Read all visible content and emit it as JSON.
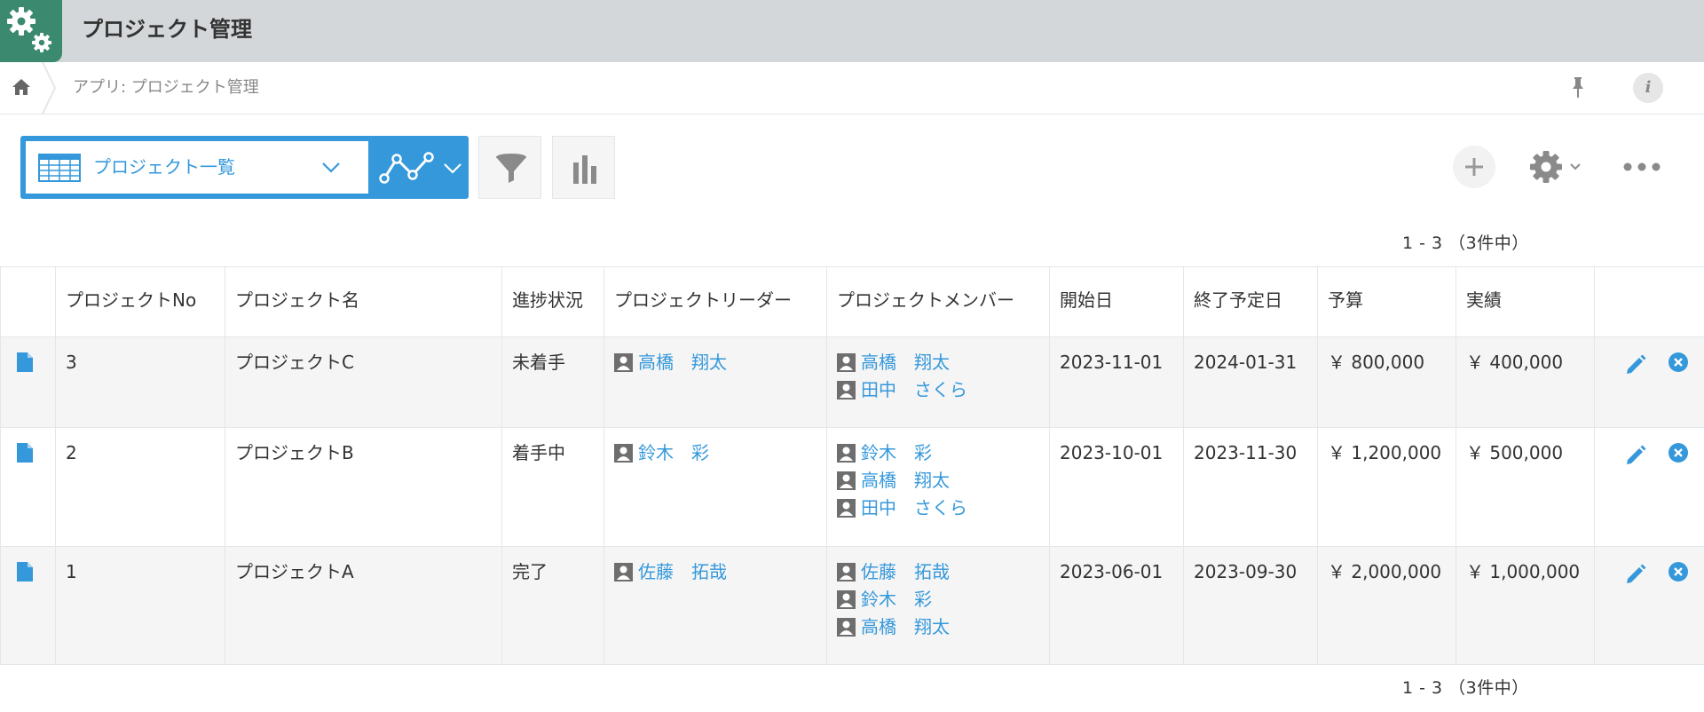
{
  "app": {
    "title": "プロジェクト管理",
    "icon": "gears-icon"
  },
  "breadcrumb": {
    "text": "アプリ: プロジェクト管理"
  },
  "toolbar": {
    "view_name": "プロジェクト一覧"
  },
  "pagination": {
    "text": "1 - 3 （3件中）"
  },
  "table": {
    "headers": [
      "プロジェクトNo",
      "プロジェクト名",
      "進捗状況",
      "プロジェクトリーダー",
      "プロジェクトメンバー",
      "開始日",
      "終了予定日",
      "予算",
      "実績"
    ],
    "rows": [
      {
        "no": "3",
        "name": "プロジェクトC",
        "status": "未着手",
        "leader": "高橋　翔太",
        "members": [
          "高橋　翔太",
          "田中　さくら"
        ],
        "start": "2023-11-01",
        "end": "2024-01-31",
        "budget": "￥ 800,000",
        "actual": "￥ 400,000"
      },
      {
        "no": "2",
        "name": "プロジェクトB",
        "status": "着手中",
        "leader": "鈴木　彩",
        "members": [
          "鈴木　彩",
          "高橋　翔太",
          "田中　さくら"
        ],
        "start": "2023-10-01",
        "end": "2023-11-30",
        "budget": "￥ 1,200,000",
        "actual": "￥ 500,000"
      },
      {
        "no": "1",
        "name": "プロジェクトA",
        "status": "完了",
        "leader": "佐藤　拓哉",
        "members": [
          "佐藤　拓哉",
          "鈴木　彩",
          "高橋　翔太"
        ],
        "start": "2023-06-01",
        "end": "2023-09-30",
        "budget": "￥ 2,000,000",
        "actual": "￥ 1,000,000"
      }
    ]
  },
  "colors": {
    "accent": "#3498db",
    "header_bg": "#d4d7d9",
    "app_icon": "#3b8a6f",
    "row_alt": "#f5f5f5"
  }
}
